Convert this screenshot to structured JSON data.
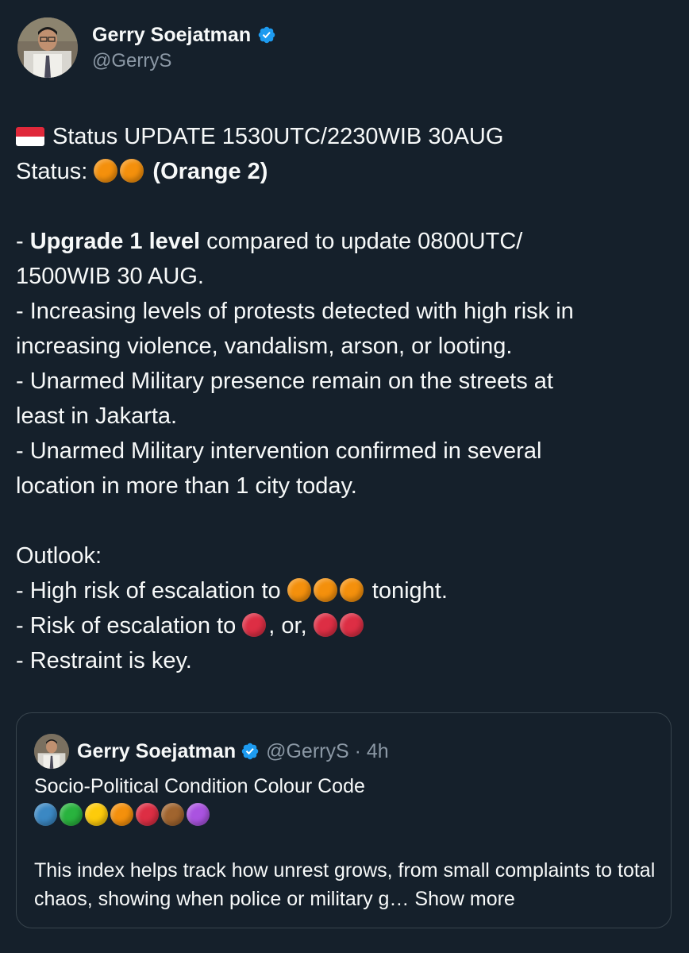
{
  "author": {
    "display_name": "Gerry Soejatman",
    "handle": "@GerryS",
    "verified": true
  },
  "post": {
    "line1_text": "Status UPDATE 1530UTC/2230WIB 30AUG",
    "status_label": "Status:",
    "status_level_text": "(Orange 2)",
    "upgrade_prefix": "- ",
    "upgrade_bold": "Upgrade 1 level",
    "upgrade_rest": " compared to update 0800UTC/",
    "upgrade_cont": "1500WIB 30 AUG.",
    "bullet2_a": "- Increasing levels of protests detected with high risk in",
    "bullet2_b": "increasing violence, vandalism, arson, or looting.",
    "bullet3_a": "- Unarmed Military presence remain on the streets at",
    "bullet3_b": "least in Jakarta.",
    "bullet4_a": "- Unarmed Military intervention confirmed in several",
    "bullet4_b": "location in more than 1 city today.",
    "outlook_label": "Outlook:",
    "outlook1_prefix": "- High risk of escalation to ",
    "outlook1_suffix": " tonight.",
    "outlook2_prefix": "- Risk of escalation to ",
    "outlook2_mid": ", or, ",
    "outlook3": "- Restraint is key."
  },
  "quoted_post": {
    "display_name": "Gerry Soejatman",
    "handle_time": "@GerryS · 4h",
    "title": "Socio-Political Condition Colour Code",
    "text": "This index helps track how unrest grows, from small complaints to total chaos, showing when police or military g…",
    "show_more_label": "Show more"
  },
  "colors": {
    "background": "#15202b",
    "verified_blue": "#1d9bf0",
    "orange": "#f4900c",
    "red": "#dd2e44",
    "blue": "#3b88c3",
    "green": "#29b33e",
    "yellow": "#fdcb0b",
    "brown": "#a0642e",
    "purple": "#aa53e0",
    "border": "#38444d",
    "muted_text": "#8b98a5"
  },
  "colour_code_dots": [
    "blue",
    "green",
    "yellow",
    "orange",
    "red",
    "brown",
    "purple"
  ]
}
